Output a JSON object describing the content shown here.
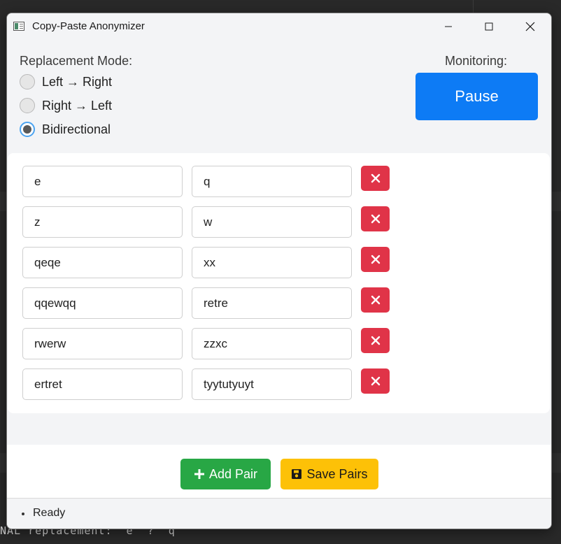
{
  "window": {
    "title": "Copy-Paste Anonymizer"
  },
  "mode": {
    "label": "Replacement Mode:",
    "options": [
      {
        "label": "Left → Right",
        "checked": false
      },
      {
        "label": "Right → Left",
        "checked": false
      },
      {
        "label": "Bidirectional",
        "checked": true
      }
    ]
  },
  "monitoring": {
    "label": "Monitoring:",
    "button": "Pause"
  },
  "pairs": [
    {
      "left": "e",
      "right": "q"
    },
    {
      "left": "z",
      "right": "w"
    },
    {
      "left": "qeqe",
      "right": "xx"
    },
    {
      "left": "qqewqq",
      "right": "retre"
    },
    {
      "left": "rwerw",
      "right": "zzxc"
    },
    {
      "left": "ertret",
      "right": "tyytutyuyt"
    }
  ],
  "actions": {
    "add_label": "Add Pair",
    "save_label": "Save Pairs"
  },
  "status": {
    "text": "Ready"
  },
  "background": {
    "terminal_text": "NAL replacement:  e  ?  q"
  },
  "colors": {
    "pause": "#0d7bf5",
    "delete": "#e03448",
    "add": "#28a745",
    "save": "#fdc107",
    "radio_focus": "#4ba3f0"
  },
  "icons": {
    "delete": "x-icon",
    "add": "plus-icon",
    "save": "floppy-disk-icon"
  }
}
